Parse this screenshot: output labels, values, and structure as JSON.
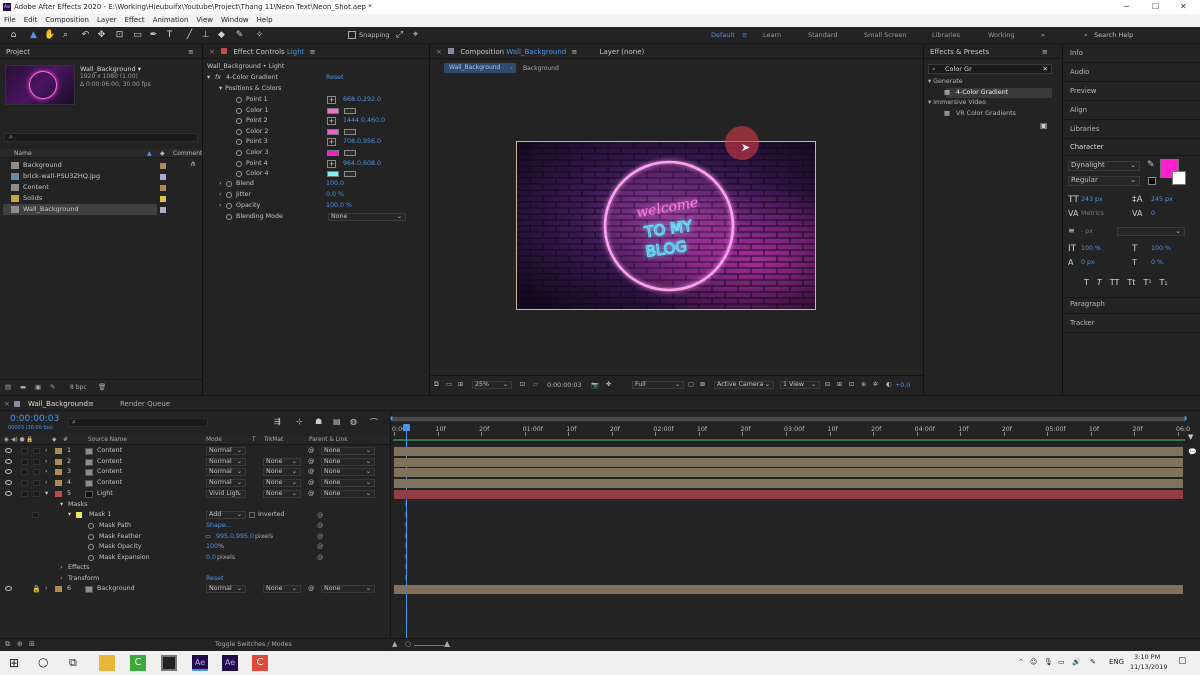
{
  "window": {
    "title": "Adobe After Effects 2020 - E:\\Working\\Hieubuifx\\Youtube\\Project\\Thang 11\\Neon Text\\Neon_Shot.aep *",
    "controls": [
      "─",
      "☐",
      "✕"
    ]
  },
  "menu": [
    "File",
    "Edit",
    "Composition",
    "Layer",
    "Effect",
    "Animation",
    "View",
    "Window",
    "Help"
  ],
  "toolbar": {
    "snapping": "Snapping",
    "workspaces": [
      "Default",
      "Learn",
      "Standard",
      "Small Screen",
      "Libraries",
      "Working"
    ],
    "search_placeholder": "Search Help"
  },
  "project": {
    "title": "Project",
    "comp_name": "Wall_Background ▾",
    "comp_size": "1920 x 1080 (1.00)",
    "comp_duration": "Δ 0:00:06:00, 30.00 fps",
    "search_placeholder": "",
    "col_name": "Name",
    "col_comment": "Comment",
    "items": [
      {
        "name": "Background",
        "color": "#b08c55"
      },
      {
        "name": "brick-wall-PSU3ZHQ.jpg",
        "color": "#a9a9c8"
      },
      {
        "name": "Content",
        "color": "#b08c55"
      },
      {
        "name": "Solids",
        "color": "#e2c34a"
      },
      {
        "name": "Wall_Background",
        "color": "#a9a9c8"
      }
    ],
    "bpc": "8 bpc"
  },
  "effect_controls": {
    "tab": "Effect Controls",
    "tab_layer": "Light",
    "subject": "Wall_Background • Light",
    "effect_name": "4-Color Gradient",
    "reset": "Reset",
    "group": "Positions & Colors",
    "rows": [
      {
        "label": "Point 1",
        "value": "668.0,292.0",
        "kind": "point"
      },
      {
        "label": "Color 1",
        "color": "#ee6fd8",
        "kind": "color"
      },
      {
        "label": "Point 2",
        "value": "1444.0,460.0",
        "kind": "point"
      },
      {
        "label": "Color 2",
        "color": "#f65bd6",
        "kind": "color"
      },
      {
        "label": "Point 3",
        "value": "708.0,956.0",
        "kind": "point"
      },
      {
        "label": "Color 3",
        "color": "#f11fc7",
        "kind": "color"
      },
      {
        "label": "Point 4",
        "value": "964.0,608.0",
        "kind": "point"
      },
      {
        "label": "Color 4",
        "color": "#7df2ee",
        "kind": "color"
      }
    ],
    "blend_label": "Blend",
    "blend": "100.0",
    "jitter_label": "Jitter",
    "jitter": "0.0 %",
    "opacity_label": "Opacity",
    "opacity": "100.0 %",
    "blending_mode_label": "Blending Mode",
    "blending_mode": "None"
  },
  "composition": {
    "tab": "Composition",
    "tab_name": "Wall_Background",
    "layer_tab": "Layer (none)",
    "breadcrumb": [
      "Wall_Background",
      "Background"
    ],
    "neon_text": [
      "welcome",
      "TO MY",
      "BLOG"
    ],
    "zoom": "25%",
    "timecode": "0:00:00:03",
    "resolution": "Full",
    "camera": "Active Camera",
    "views": "1 View",
    "exposure": "+0.0"
  },
  "effects_presets": {
    "title": "Effects & Presets",
    "search": "Color Gr",
    "categories": [
      {
        "name": "Generate",
        "items": [
          "4-Color Gradient"
        ]
      },
      {
        "name": "Immersive Video",
        "items": [
          "VR Color Gradients"
        ]
      }
    ]
  },
  "right_panels": {
    "items": [
      "Info",
      "Audio",
      "Preview",
      "Align",
      "Libraries"
    ],
    "character": {
      "title": "Character",
      "font": "Dynalight",
      "style": "Regular",
      "fill_color": "#ff1fcf",
      "size": "243 px",
      "leading": "245 px",
      "kerning": "Metrics",
      "tracking": "0",
      "indent": "- px",
      "vscale": "100 %",
      "hscale": "100 %",
      "baseline": "0 px",
      "tsume": "0 %",
      "style_buttons": [
        "T",
        "T",
        "TT",
        "Tt",
        "T¹",
        "T₁"
      ]
    },
    "after": [
      "Paragraph",
      "Tracker"
    ]
  },
  "timeline": {
    "tab": "Wall_Background",
    "render_queue": "Render Queue",
    "timecode": "0:00:00:03",
    "timecode_sub": "00003 (30.00 fps)",
    "headers": {
      "source": "Source Name",
      "mode": "Mode",
      "t": "T",
      "trkmat": "TrkMat",
      "parent": "Parent & Link"
    },
    "ruler": [
      "0:00f",
      "10f",
      "20f",
      "01:00f",
      "10f",
      "20f",
      "02:00f",
      "10f",
      "20f",
      "03:00f",
      "10f",
      "20f",
      "04:00f",
      "10f",
      "20f",
      "05:00f",
      "10f",
      "20f",
      "06:0"
    ],
    "layers": [
      {
        "num": "1",
        "name": "Content",
        "mode": "Normal",
        "trkmat": "",
        "parent": "None",
        "color": "#b08c55",
        "bar": "#7f735e"
      },
      {
        "num": "2",
        "name": "Content",
        "mode": "Normal",
        "trkmat": "None",
        "parent": "None",
        "color": "#b08c55",
        "bar": "#7f735e"
      },
      {
        "num": "3",
        "name": "Content",
        "mode": "Normal",
        "trkmat": "None",
        "parent": "None",
        "color": "#b08c55",
        "bar": "#7f735e"
      },
      {
        "num": "4",
        "name": "Content",
        "mode": "Normal",
        "trkmat": "None",
        "parent": "None",
        "color": "#b08c55",
        "bar": "#7f735e"
      },
      {
        "num": "5",
        "name": "Light",
        "mode": "Vivid Ligh",
        "trkmat": "None",
        "parent": "None",
        "color": "#c24a4a",
        "bar": "#8e3e44"
      }
    ],
    "masks_label": "Masks",
    "mask1": "Mask 1",
    "mask1_mode": "Add",
    "inverted": "Inverted",
    "mask_props": [
      {
        "label": "Mask Path",
        "value": "Shape..."
      },
      {
        "label": "Mask Feather",
        "value": "995.0,995.0",
        "unit": "pixels"
      },
      {
        "label": "Mask Opacity",
        "value": "100",
        "unit": "%"
      },
      {
        "label": "Mask Expansion",
        "value": "0.0",
        "unit": "pixels"
      }
    ],
    "effects_label": "Effects",
    "transform_label": "Transform",
    "transform_reset": "Reset",
    "layer6": {
      "num": "6",
      "name": "Background",
      "mode": "Normal",
      "trkmat": "None",
      "parent": "None"
    },
    "toggle": "Toggle Switches / Modes"
  },
  "taskbar": {
    "lang": "ENG",
    "time": "3:10 PM",
    "date": "11/13/2019"
  }
}
